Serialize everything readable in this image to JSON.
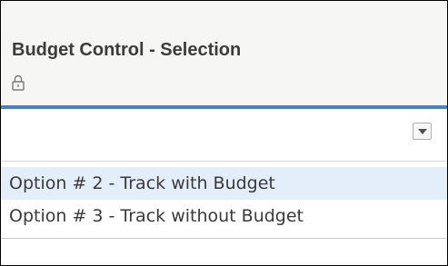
{
  "field": {
    "label": "Budget Control - Selection",
    "locked_icon": "lock-icon"
  },
  "select": {
    "current_value": "",
    "dropdown_icon": "triangle-down-icon"
  },
  "options": [
    {
      "label": "Option # 2 - Track with Budget",
      "highlighted": true
    },
    {
      "label": "Option # 3 - Track without Budget",
      "highlighted": false
    }
  ],
  "colors": {
    "accent": "#4f7fc2",
    "header_background": "#f6f6f5",
    "highlight": "#e4eefa"
  }
}
